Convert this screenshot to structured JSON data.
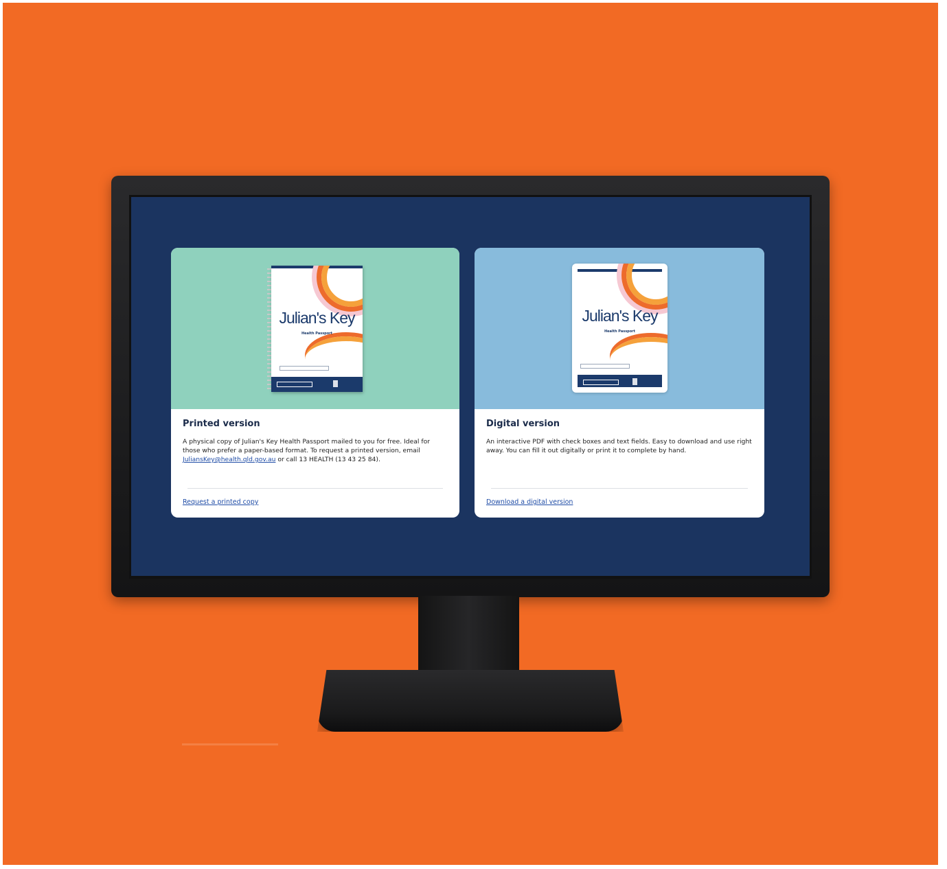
{
  "colors": {
    "background": "#f26a24",
    "screen": "#1b3460",
    "printed_hero": "#8fd1bd",
    "digital_hero": "#88bbdc",
    "link": "#1f4ca6",
    "booklet_navy": "#1b3a6b"
  },
  "cards": [
    {
      "booklet": {
        "title": "Julian's Key",
        "subtitle": "Health Passport"
      },
      "heading": "Printed version",
      "text_before_email": "A physical copy of Julian's Key Health Passport mailed to you for free. Ideal for those who prefer a paper-based format. To request a printed version, email",
      "email": " JuliansKey@health.qld.gov.au",
      "text_after_email": " or call 13 HEALTH (13 43 25 84).",
      "link": "Request a printed copy"
    },
    {
      "booklet": {
        "title": "Julian's Key",
        "subtitle": "Health Passport"
      },
      "heading": "Digital version",
      "text": "An interactive PDF with check boxes and text fields. Easy to download and use right away. You can fill it out digitally or print it to complete by hand.",
      "link": "Download a digital version"
    }
  ]
}
